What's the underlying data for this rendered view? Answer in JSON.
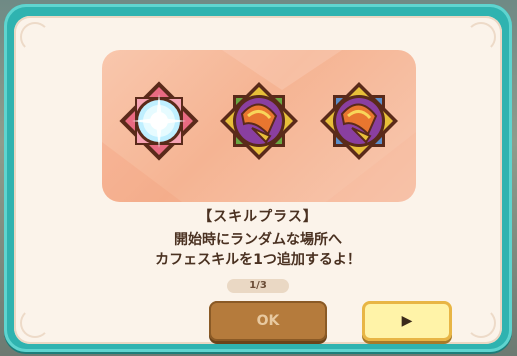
{
  "dialog": {
    "title": "【スキルプラス】",
    "description_lines": [
      "開始時にランダムな場所へ",
      "カフェスキルを1つ追加するよ！"
    ],
    "page_indicator": "1/3",
    "ok_label": "OK",
    "next_label": "▶"
  },
  "badges": [
    {
      "name": "pink-sparkle-badge",
      "frame_color": "#e96b82",
      "accent": "#f6a3b4",
      "core": "sparkle"
    },
    {
      "name": "green-horn-badge",
      "frame_color": "#6aa842",
      "accent": "#e8bf3a",
      "core": "horn"
    },
    {
      "name": "blue-horn-badge",
      "frame_color": "#5b8ec9",
      "accent": "#e8bf3a",
      "core": "horn"
    }
  ],
  "colors": {
    "dialog_border": "#2fb3b0",
    "panel_bg": "#fbf3ea",
    "text": "#4a3121",
    "ok_button": "#b57b3c",
    "next_button": "#fff3a8"
  }
}
